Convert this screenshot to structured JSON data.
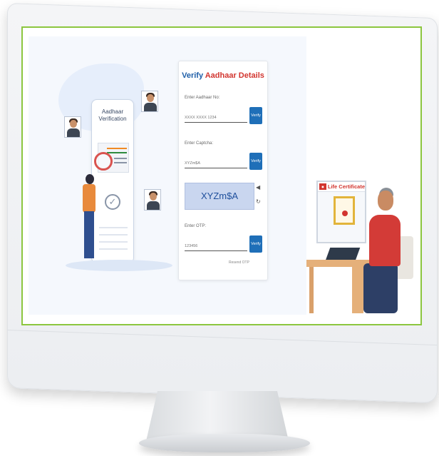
{
  "illustration": {
    "phone_title": "Aadhaar Verification"
  },
  "form": {
    "title_part1": "Verify",
    "title_part2": "Aadhaar Details",
    "aadhaar_label": "Enter Aadhaar No:",
    "aadhaar_placeholder": "XXXX XXXX 1234",
    "captcha_label": "Enter Captcha:",
    "captcha_placeholder": "XYZm$A",
    "captcha_text": "XYZm$A",
    "otp_label": "Enter OTP:",
    "otp_placeholder": "123456",
    "verify_label": "Verify",
    "resend_label": "Resend OTP"
  },
  "life_certificate": {
    "title": "Life Certificate"
  },
  "colors": {
    "screen_border": "#8cc63f",
    "primary_blue": "#1f6fb8",
    "accent_red": "#d2352f"
  }
}
